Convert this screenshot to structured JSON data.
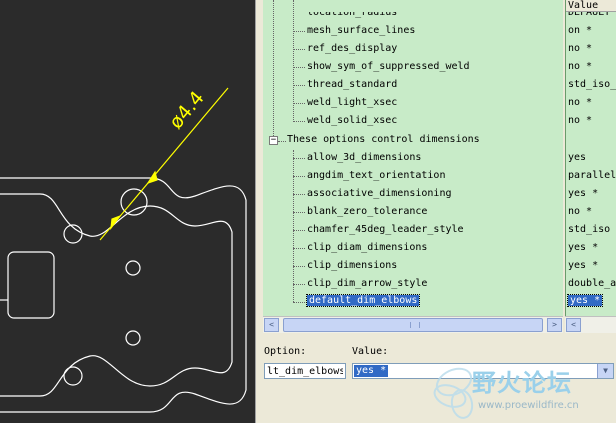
{
  "drawing": {
    "dimension_label": "ø4.4",
    "colors": {
      "background": "#2b2b2b",
      "geometry": "#ffffff",
      "dimension": "#ffff00"
    }
  },
  "tree": {
    "cut_top_label": "location_radius",
    "items_top": [
      {
        "name": "mesh_surface_lines",
        "value": "on *"
      },
      {
        "name": "ref_des_display",
        "value": "no *"
      },
      {
        "name": "show_sym_of_suppressed_weld",
        "value": "no *"
      },
      {
        "name": "thread_standard",
        "value": "std_iso_"
      },
      {
        "name": "weld_light_xsec",
        "value": "no *"
      },
      {
        "name": "weld_solid_xsec",
        "value": "no *"
      }
    ],
    "group_label": "These options control dimensions",
    "group_expander": "−",
    "items_group": [
      {
        "name": "allow_3d_dimensions",
        "value": "yes"
      },
      {
        "name": "angdim_text_orientation",
        "value": "parallel"
      },
      {
        "name": "associative_dimensioning",
        "value": "yes *"
      },
      {
        "name": "blank_zero_tolerance",
        "value": "no *"
      },
      {
        "name": "chamfer_45deg_leader_style",
        "value": "std_iso"
      },
      {
        "name": "clip_diam_dimensions",
        "value": "yes *"
      },
      {
        "name": "clip_dimensions",
        "value": "yes *"
      },
      {
        "name": "clip_dim_arrow_style",
        "value": "double_a"
      },
      {
        "name": "default_dim_elbows",
        "value": "yes *",
        "selected": true
      }
    ]
  },
  "value_column": {
    "header": "Value",
    "cut_top_value": "DEFAULT"
  },
  "scrollbar": {
    "left_arrow": "<",
    "right_arrow": ">"
  },
  "bottom": {
    "option_label": "Option:",
    "value_label": "Value:",
    "option_value": "lt_dim_elbows",
    "value_selected": "yes *",
    "dropdown_arrow": "▼"
  },
  "watermark": {
    "text": "野火论坛",
    "url": "www.proewildfire.cn"
  }
}
